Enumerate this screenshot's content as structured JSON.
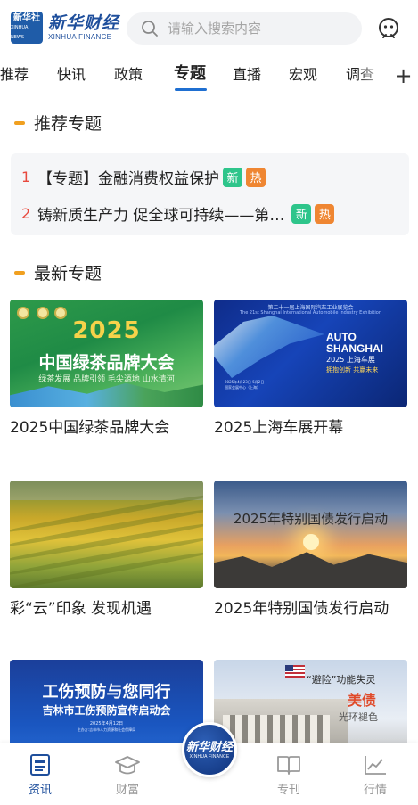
{
  "header": {
    "logo_badge": "新华社",
    "logo_badge_sub": "XINHUA NEWS",
    "logo_cn": "新华财经",
    "logo_en": "XINHUA FINANCE",
    "search_placeholder": "请输入搜索内容"
  },
  "tabs": [
    {
      "label": "推荐"
    },
    {
      "label": "快讯"
    },
    {
      "label": "政策"
    },
    {
      "label": "专题",
      "active": true
    },
    {
      "label": "直播"
    },
    {
      "label": "宏观"
    },
    {
      "label": "调查"
    }
  ],
  "recommended": {
    "title": "推荐专题",
    "items": [
      {
        "index": "1",
        "text": "【专题】金融消费权益保护",
        "badges": [
          "新",
          "热"
        ]
      },
      {
        "index": "2",
        "text": "铸新质生产力 促全球可持续——第…",
        "badges": [
          "新",
          "热"
        ]
      }
    ]
  },
  "latest": {
    "title": "最新专题",
    "topics": [
      {
        "title": "2025中国绿茶品牌大会",
        "thumb": {
          "year": "2025",
          "name": "中国绿茶品牌大会",
          "sub": "绿茶发展  品牌引领  毛尖源地  山水清河"
        }
      },
      {
        "title": "2025上海车展开幕",
        "thumb": {
          "hdr": "第二十一届上海国际汽车工业展览会",
          "hdr2": "The 21st Shanghai International Automobile Industry Exhibition",
          "brand_line1": "AUTO",
          "brand_line2": "SHANGHAI",
          "year": "2025 上海车展",
          "slogan": "拥抱创新  共赢未来",
          "info": "2025年4月23日-5月2日\n国家会展中心（上海）"
        }
      },
      {
        "title": "彩“云”印象  发现机遇",
        "thumb": {}
      },
      {
        "title": "2025年特别国债发行启动",
        "thumb": {
          "caption": "2025年特别国债发行启动"
        }
      },
      {
        "title": "",
        "thumb": {
          "t1": "工伤预防与您同行",
          "t2": "吉林市工伤预防宣传启动会",
          "t3": "2025年4月12日",
          "t4": "主办方:吉林市人力资源和社会保障局"
        }
      },
      {
        "title": "",
        "thumb": {
          "q": "“避险”功能失灵",
          "mb": "美债",
          "sub": "光环褪色"
        }
      }
    ]
  },
  "bottom_nav": {
    "items": [
      {
        "label": "资讯",
        "active": true
      },
      {
        "label": "财富"
      },
      {
        "label": "专刊"
      },
      {
        "label": "行情"
      }
    ],
    "center_cn": "新华财经",
    "center_en": "XINHUA FINANCE"
  }
}
